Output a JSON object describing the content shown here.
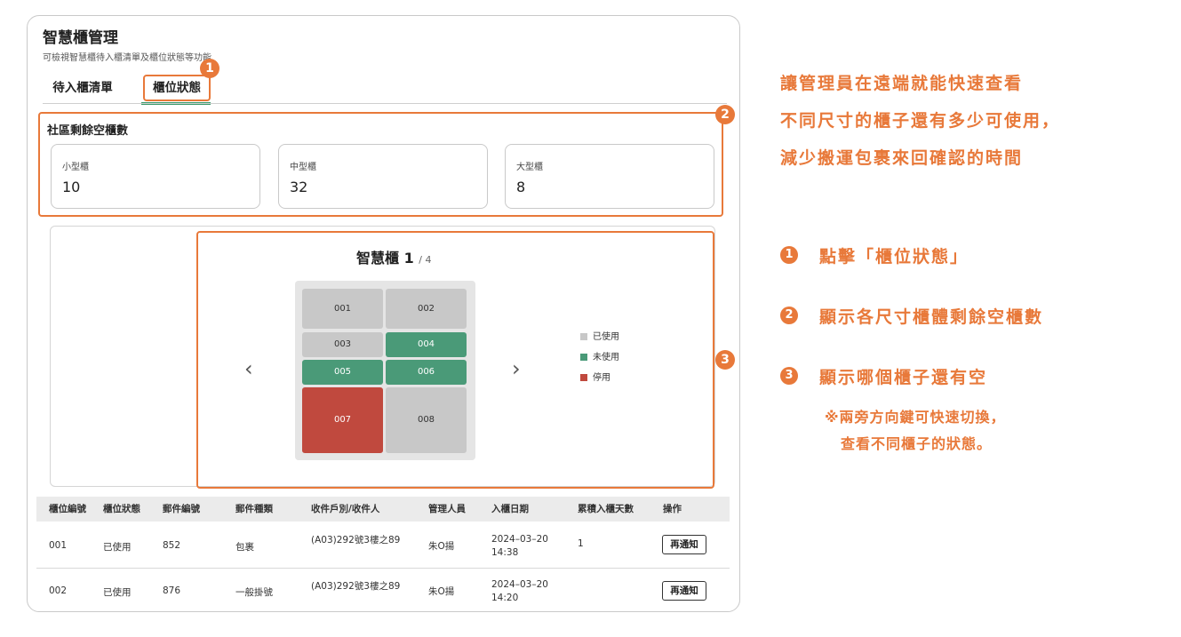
{
  "panel": {
    "title": "智慧櫃管理",
    "subtitle": "可檢視智慧櫃待入櫃清單及櫃位狀態等功能",
    "tabs": [
      {
        "label": "待入櫃清單"
      },
      {
        "label": "櫃位狀態"
      }
    ]
  },
  "badges": [
    "1",
    "2",
    "3"
  ],
  "summary": {
    "title": "社區剩餘空櫃數",
    "cards": [
      {
        "label": "小型櫃",
        "value": "10"
      },
      {
        "label": "中型櫃",
        "value": "32"
      },
      {
        "label": "大型櫃",
        "value": "8"
      }
    ]
  },
  "locker": {
    "title": "智慧櫃 1",
    "page": "/ 4",
    "prev_icon": "‹",
    "next_icon": "›",
    "cells": [
      {
        "id": "001",
        "status": "used"
      },
      {
        "id": "002",
        "status": "used"
      },
      {
        "id": "003",
        "status": "used"
      },
      {
        "id": "004",
        "status": "free"
      },
      {
        "id": "005",
        "status": "free"
      },
      {
        "id": "006",
        "status": "free"
      },
      {
        "id": "007",
        "status": "off"
      },
      {
        "id": "008",
        "status": "used"
      }
    ],
    "legend": [
      {
        "label": "已使用",
        "color": "#c8c8c8"
      },
      {
        "label": "未使用",
        "color": "#4a9a78"
      },
      {
        "label": "停用",
        "color": "#c0493e"
      }
    ]
  },
  "table": {
    "headers": [
      "櫃位編號",
      "櫃位狀態",
      "郵件編號",
      "郵件種類",
      "收件戶別/收件人",
      "管理人員",
      "入櫃日期",
      "累積入櫃天數",
      "操作"
    ],
    "rows": [
      {
        "locker": "001",
        "status": "已使用",
        "mail_no": "852",
        "mail_type": "包裹",
        "recipient": "(A03)292號3樓之89",
        "staff": "朱O揚",
        "date": "2024–03–20",
        "time": "14:38",
        "days": "1",
        "action": "再通知"
      },
      {
        "locker": "002",
        "status": "已使用",
        "mail_no": "876",
        "mail_type": "一般掛號",
        "recipient": "(A03)292號3樓之89",
        "staff": "朱O揚",
        "date": "2024–03–20",
        "time": "14:20",
        "days": "",
        "action": "再通知"
      }
    ]
  },
  "annotations": {
    "headline": [
      "讓管理員在遠端就能快速查看",
      "不同尺寸的櫃子還有多少可使用，",
      "減少搬運包裹來回確認的時間"
    ],
    "items": [
      {
        "num": "1",
        "text": "點擊「櫃位狀態」"
      },
      {
        "num": "2",
        "text": "顯示各尺寸櫃體剩餘空櫃數"
      },
      {
        "num": "3",
        "text": "顯示哪個櫃子還有空"
      }
    ],
    "note": [
      "※兩旁方向鍵可快速切換，",
      "查看不同櫃子的狀態。"
    ]
  },
  "colors": {
    "accent": "#e8793a",
    "tab_underline": "#3a9a6a"
  }
}
